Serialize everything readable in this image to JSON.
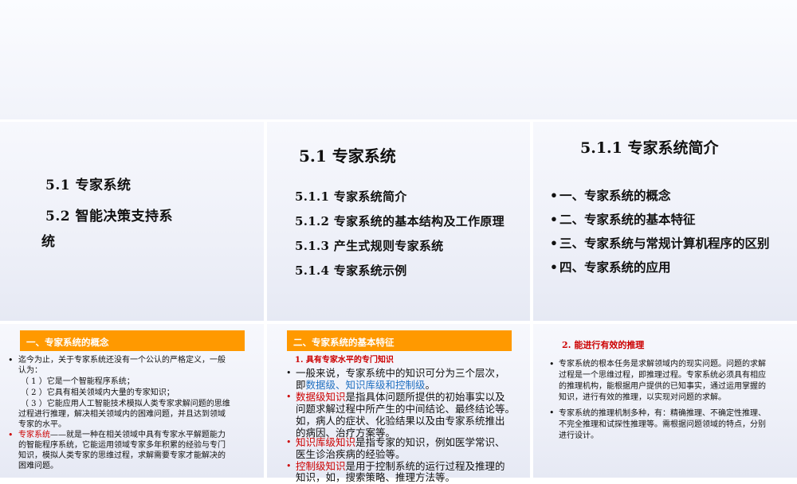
{
  "slide1": {
    "line1": "5.1  专家系统",
    "line2": "5.2   智能决策支持系",
    "line3": "统"
  },
  "slide2": {
    "title": "5.1  专家系统",
    "items": [
      "5.1.1   专家系统简介",
      "5.1.2   专家系统的基本结构及工作原理",
      "5.1.3   产生式规则专家系统",
      "5.1.4   专家系统示例"
    ]
  },
  "slide3": {
    "title": "5.1.1   专家系统简介",
    "items": [
      "一、专家系统的概念",
      "二、专家系统的基本特征",
      "三、专家系统与常规计算机程序的区别",
      "四、专家系统的应用"
    ]
  },
  "slide4": {
    "header": "一、专家系统的概念",
    "b1_l1": "迄今为止，关于专家系统还没有一个公认的严格定义，一般",
    "b1_l2": "认为：",
    "sub1": "（ 1 ）它是一个智能程序系统；",
    "sub2": "（ 2 ）它具有相关领域内大量的专家知识；",
    "sub3_l1": "（ 3 ）它能应用人工智能技术模拟人类专家求解问题的思维",
    "sub3_l2": "过程进行推理，解决相关领域内的困难问题，并且达到领域",
    "sub3_l3": "专家的水平。",
    "b2_term": "专家系统",
    "b2_l1": "——就是一种在相关领域中具有专家水平解题能力",
    "b2_l2": "的智能程序系统，它能运用领域专家多年积累的经验与专门",
    "b2_l3": "知识，模拟人类专家的思维过程，求解需要专家才能解决的",
    "b2_l4": "困难问题。"
  },
  "slide5": {
    "header": "二、专家系统的基本特征",
    "subtitle": "1. 具有专家水平的专门知识",
    "p1_l1": "一般来说，专家系统中的知识可分为三个层次，",
    "p1_l2a": "即",
    "p1_l2b": "数据级、知识库级和控制级",
    "p1_l2c": "。",
    "p2_term": "数据级知识",
    "p2_l1": "是指具体问题所提供的初始事实以及",
    "p2_l2": "问题求解过程中所产生的中间结论、最终结论等。",
    "p2_l3": "如，病人的症状、化验结果以及由专家系统推出",
    "p2_l4": "的病因、治疗方案等。",
    "p3_term": "知识库级知识",
    "p3_l1": "是指专家的知识，例如医学常识、",
    "p3_l2": "医生诊治疾病的经验等。",
    "p4_term": "控制级知识",
    "p4_l1": "是用于控制系统的运行过程及推理的",
    "p4_l2": "知识，如，搜索策略、推理方法等。"
  },
  "slide6": {
    "subtitle": "2.  能进行有效的推理",
    "b1_l1": "专家系统的根本任务是求解领域内的现实问题。问题的求解",
    "b1_l2": "过程是一个思维过程，即推理过程。专家系统必须具有相应",
    "b1_l3": "的推理机构，能根据用户提供的已知事实，通过运用掌握的",
    "b1_l4": "知识，进行有效的推理，以实现对问题的求解。",
    "b2_l1": "专家系统的推理机制多种，有：精确推理、不确定性推理、",
    "b2_l2": "不完全推理和试探性推理等。需根据问题领域的特点，分别",
    "b2_l3": "进行设计。"
  },
  "colors": {
    "accent_orange": "#ff9900",
    "red": "#cc0000",
    "blue": "#1f6fc0"
  }
}
